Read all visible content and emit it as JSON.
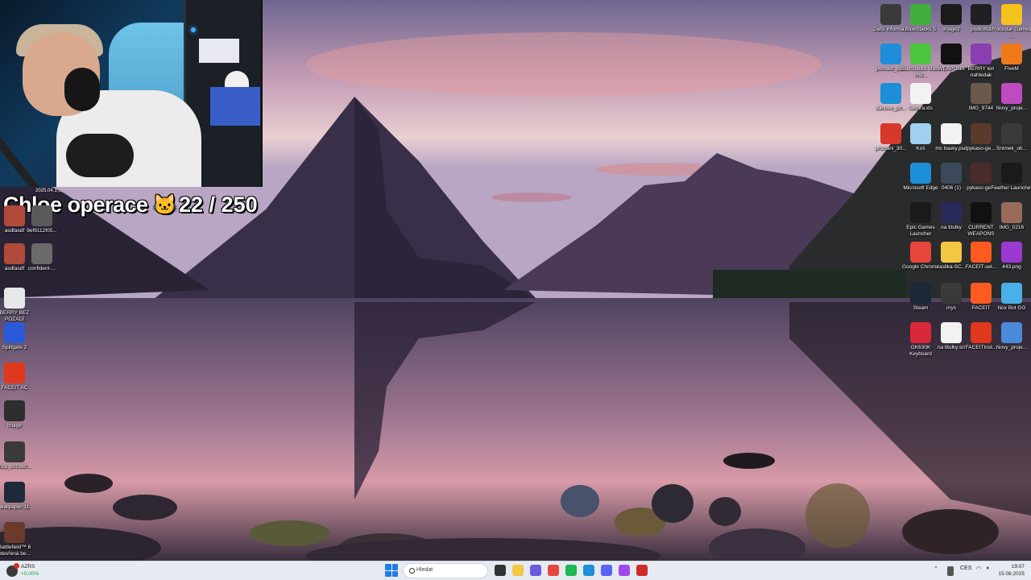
{
  "overlay": {
    "title": "Chloe operace",
    "emoji": "🐱",
    "counter": "22 / 250",
    "webcam_caption": "2025.04.1..."
  },
  "desktop_left": [
    {
      "label": "asdfasdf",
      "icon": "image-thumb-icon",
      "color": "#b04a3a"
    },
    {
      "label": "9ef9112f05...",
      "icon": "image-thumb-icon",
      "color": "#5a5a5a"
    },
    {
      "label": "asdfasdf",
      "icon": "image-thumb-icon",
      "color": "#b04a3a"
    },
    {
      "label": "confident-...",
      "icon": "image-thumb-icon",
      "color": "#6a6a6a"
    },
    {
      "label": "BERRY BEZ POZADÍ",
      "icon": "image-thumb-icon",
      "color": "#e8e8e8"
    },
    {
      "label": "Splitgate 2",
      "icon": "splitgate-icon",
      "color": "#2a5ad8"
    },
    {
      "label": "FACEIT AC",
      "icon": "faceit-shield-icon",
      "color": "#e0381c"
    },
    {
      "label": "image",
      "icon": "image-thumb-icon",
      "color": "#2e2e2e"
    },
    {
      "label": "alza_600x60...",
      "icon": "image-thumb-icon",
      "color": "#3a3a3a"
    },
    {
      "label": "wallpaper-11",
      "icon": "image-thumb-icon",
      "color": "#1e2a3a"
    },
    {
      "label": "Battlefield™ 6 otevřená be...",
      "icon": "battlefield-icon",
      "color": "#6b3a2a"
    }
  ],
  "desktop_right": [
    {
      "label": "Další informa...",
      "icon": "info-circle-icon",
      "color": "#3a3a3a"
    },
    {
      "label": "BlueStacks 5",
      "icon": "bluestacks-icon",
      "color": "#3fae3c"
    },
    {
      "label": "image2",
      "icon": "phone-image-icon",
      "color": "#1a1a1a"
    },
    {
      "label": "podlozka",
      "icon": "image-thumb-icon",
      "color": "#202020"
    },
    {
      "label": "Rockstar Games ...",
      "icon": "rockstar-icon",
      "color": "#f3c21b"
    },
    {
      "label": "prehled_str...",
      "icon": "edge-icon",
      "color": "#1d8fd8"
    },
    {
      "label": "BlueStacks Multi-Inst...",
      "icon": "bluestacks-multi-icon",
      "color": "#4cc43e"
    },
    {
      "label": "WEAPONS",
      "icon": "image-thumb-icon",
      "color": "#111111"
    },
    {
      "label": "BERRY len nahledak",
      "icon": "image-thumb-icon",
      "color": "#8a3fb0"
    },
    {
      "label": "FiveM",
      "icon": "fivem-icon",
      "color": "#f07a1a"
    },
    {
      "label": "danove_pri...",
      "icon": "edge-icon",
      "color": "#1d8fd8"
    },
    {
      "label": "faktura.xls",
      "icon": "document-icon",
      "color": "#f2f2f2"
    },
    {
      "label": "IMG_9744",
      "icon": "image-thumb-icon",
      "color": "#6a5a4a"
    },
    {
      "label": "Novy_proje...",
      "icon": "image-thumb-icon",
      "color": "#c04ac0"
    },
    {
      "label": "priznani_30...",
      "icon": "pdf-icon",
      "color": "#d8382c"
    },
    {
      "label": "Koš",
      "icon": "recycle-bin-icon",
      "color": "#9fd0f0"
    },
    {
      "label": "mc basky.psd",
      "icon": "document-icon",
      "color": "#f2f2f2"
    },
    {
      "label": "pykaso-ge...",
      "icon": "image-thumb-icon",
      "color": "#5a3a2a"
    },
    {
      "label": "Snimek_ob...",
      "icon": "image-thumb-icon",
      "color": "#3a3a3a"
    },
    {
      "label": "Microsoft Edge",
      "icon": "edge-icon",
      "color": "#1d8fd8"
    },
    {
      "label": "0406 (1)",
      "icon": "image-thumb-icon",
      "color": "#3a4a5a"
    },
    {
      "label": "pykaso-ge...",
      "icon": "image-thumb-icon",
      "color": "#4a2a2a"
    },
    {
      "label": "Feather Launcher",
      "icon": "feather-icon",
      "color": "#1a1a1a"
    },
    {
      "label": "Epic Games Launcher",
      "icon": "epic-games-icon",
      "color": "#1a1a1a"
    },
    {
      "label": "na titulky",
      "icon": "image-thumb-icon",
      "color": "#2a2a5a"
    },
    {
      "label": "CURRENT WEAPONS",
      "icon": "image-thumb-icon",
      "color": "#111111"
    },
    {
      "label": "IMG_0216",
      "icon": "image-thumb-icon",
      "color": "#9a6a5a"
    },
    {
      "label": "Google Chrome",
      "icon": "chrome-icon",
      "color": "#e8453c"
    },
    {
      "label": "zasilka-SC...",
      "icon": "folder-icon",
      "color": "#f2c744"
    },
    {
      "label": "FACEIT-set...",
      "icon": "faceit-icon",
      "color": "#ff5a1f"
    },
    {
      "label": "443.png",
      "icon": "image-thumb-icon",
      "color": "#9a3ad0"
    },
    {
      "label": "Steam",
      "icon": "steam-icon",
      "color": "#1b2838"
    },
    {
      "label": "mys",
      "icon": "image-thumb-icon",
      "color": "#3a3a3a"
    },
    {
      "label": "FACEIT",
      "icon": "faceit-icon",
      "color": "#ff5a1f"
    },
    {
      "label": "Nox Bot GG",
      "icon": "nox-bot-icon",
      "color": "#4ab0e8"
    },
    {
      "label": "GK630K Keyboard",
      "icon": "keyboard-app-icon",
      "color": "#d8283a"
    },
    {
      "label": "na titulky.srt",
      "icon": "document-icon",
      "color": "#f2f2f2"
    },
    {
      "label": "FACEITInst...",
      "icon": "faceit-shield-icon",
      "color": "#e0381c"
    },
    {
      "label": "Novy_proje...",
      "icon": "image-thumb-icon",
      "color": "#4a8ad8"
    }
  ],
  "taskbar": {
    "weather_name": "AZRS",
    "weather_value": "+0,00%",
    "search_placeholder": "Hledat",
    "apps": [
      {
        "name": "task-view-icon",
        "color": "#333333"
      },
      {
        "name": "file-explorer-icon",
        "color": "#f2c744"
      },
      {
        "name": "copilot-icon",
        "color": "#6a5ae0"
      },
      {
        "name": "chrome-icon",
        "color": "#e8453c"
      },
      {
        "name": "spotify-icon",
        "color": "#1db954"
      },
      {
        "name": "edge-icon",
        "color": "#1d8fd8"
      },
      {
        "name": "discord-icon",
        "color": "#5865f2"
      },
      {
        "name": "messenger-icon",
        "color": "#a048f0"
      },
      {
        "name": "recorder-icon",
        "color": "#d02a2a"
      }
    ],
    "tray_lang": "CES",
    "time": "19:07",
    "date": "15.08.2025"
  }
}
